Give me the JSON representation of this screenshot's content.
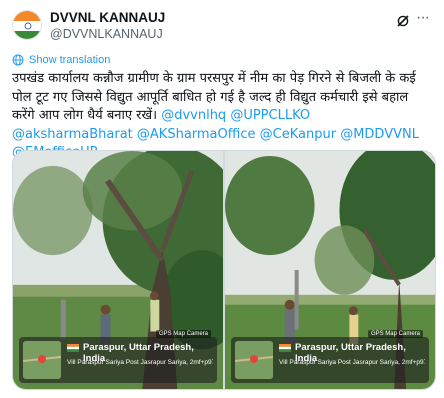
{
  "author": {
    "display_name": "DVVNL KANNAUJ",
    "handle": "@DVVNLKANNAUJ",
    "avatar_icon": "india-flag-avatar-icon"
  },
  "actions": {
    "grok_icon": "grok-icon",
    "more_icon": "more-options-icon"
  },
  "translation": {
    "label": "Show translation",
    "icon": "globe-icon"
  },
  "tweet": {
    "body": "उपखंड कार्यालय कन्नौज ग्रामीण के ग्राम परसपुर में नीम का पेड़ गिरने से बिजली के कई पोल टूट गए जिससे विद्युत आपूर्ति बाधित हो गई है जल्द ही विद्युत कर्मचारी इसे बहाल करेंगे आप लोग धैर्य बनाए रखें।",
    "mentions": [
      "@dvvnlhq",
      "@UPPCLLKO",
      "@aksharmaBharat",
      "@AKSharmaOffice",
      "@CeKanpur",
      "@MDDVVNL",
      "@EMofficeUP"
    ]
  },
  "media": [
    {
      "gps_tag": "GPS Map Camera",
      "location": "Paraspur, Uttar Pradesh, India",
      "address": "Vill Paraspur Sariya Post Jasrapur Sariya, 2mf+p97,"
    },
    {
      "gps_tag": "GPS Map Camera",
      "location": "Paraspur, Uttar Pradesh, India",
      "address": "Vill Paraspur Sariya Post Jasrapur Sariya, 2mf+p97,"
    }
  ],
  "colors": {
    "accent": "#1d9bf0",
    "text": "#0f1419",
    "muted": "#536471"
  }
}
